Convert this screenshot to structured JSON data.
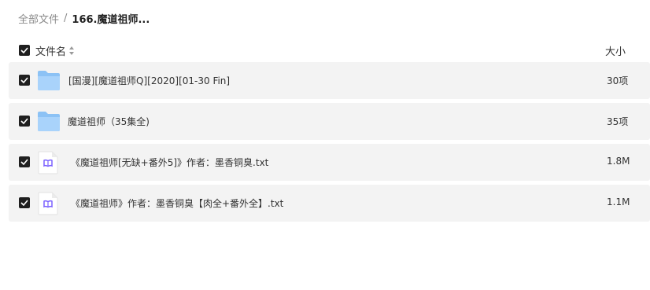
{
  "breadcrumb": {
    "root": "全部文件",
    "separator": "/",
    "current": "166.魔道祖师..."
  },
  "header": {
    "name_label": "文件名",
    "size_label": "大小",
    "sort_icon": "sort-up-down-icon"
  },
  "files": [
    {
      "name": "[国漫][魔道祖师Q][2020][01-30 Fin]",
      "size": "30项",
      "type": "folder",
      "icon": "folder-icon"
    },
    {
      "name": "魔道祖师（35集全)",
      "size": "35项",
      "type": "folder",
      "icon": "folder-icon"
    },
    {
      "name": "《魔道祖师[无缺+番外5]》作者：墨香铜臭.txt",
      "size": "1.8M",
      "type": "txt",
      "icon": "book-file-icon"
    },
    {
      "name": "《魔道祖师》作者：墨香铜臭【肉全+番外全】.txt",
      "size": "1.1M",
      "type": "txt",
      "icon": "book-file-icon"
    }
  ],
  "colors": {
    "row_background": "#f3f3f3",
    "folder_blue": "#8cc2f5",
    "checkbox": "#1f1f1f",
    "doc_icon_purple": "#7b61ff"
  }
}
